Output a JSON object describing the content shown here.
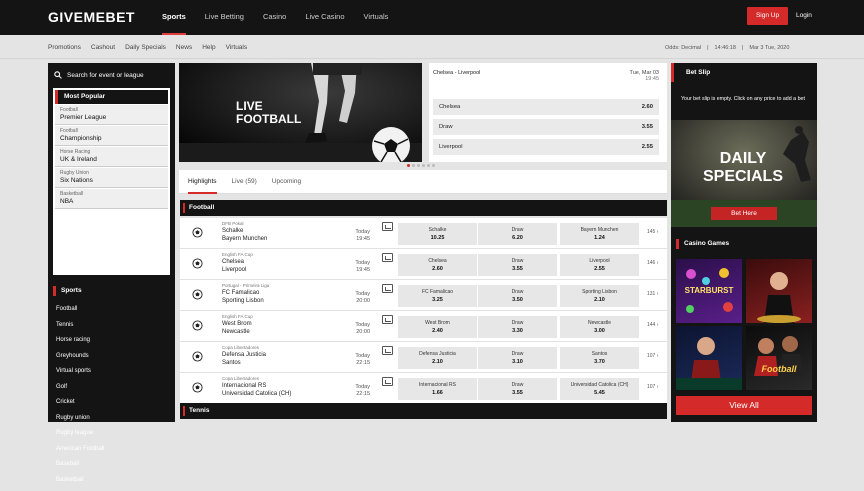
{
  "header": {
    "logo": "GIVEMEBET",
    "nav": [
      "Sports",
      "Live Betting",
      "Casino",
      "Live Casino",
      "Virtuals"
    ],
    "signup": "Sign Up",
    "login": "Login"
  },
  "subnav": {
    "items": [
      "Promotions",
      "Cashout",
      "Daily Specials",
      "News",
      "Help",
      "Virtuals"
    ],
    "odds": "Odds: Decimal",
    "time": "14:46:18",
    "date": "Mar 3 Tue, 2020"
  },
  "sidebar": {
    "search_label": "Search for event or league",
    "most_popular": "Most Popular",
    "popular": [
      {
        "sport": "Football",
        "league": "Premier League"
      },
      {
        "sport": "Football",
        "league": "Championship"
      },
      {
        "sport": "Horse Racing",
        "league": "UK & Ireland"
      },
      {
        "sport": "Rugby Union",
        "league": "Six Nations"
      },
      {
        "sport": "Basketball",
        "league": "NBA"
      }
    ],
    "sports_title": "Sports",
    "sports": [
      "Football",
      "Tennis",
      "Horse racing",
      "Greyhounds",
      "Virtual sports",
      "Golf",
      "Cricket",
      "Rugby union",
      "Rugby league",
      "American Football",
      "Baseball",
      "Basketball"
    ]
  },
  "hero": {
    "line1": "LIVE",
    "line2": "FOOTBALL",
    "match": "Chelsea - Liverpool",
    "date": "Tue, Mar 03",
    "time": "19:45",
    "odds": [
      {
        "name": "Chelsea",
        "price": "2.60"
      },
      {
        "name": "Draw",
        "price": "3.55"
      },
      {
        "name": "Liverpool",
        "price": "2.55"
      }
    ]
  },
  "tabs": [
    "Highlights",
    "Live (59)",
    "Upcoming"
  ],
  "sections": {
    "football": "Football",
    "tennis": "Tennis"
  },
  "matches": [
    {
      "comp": "DFB Pokal",
      "home": "Schalke",
      "away": "Bayern Munchen",
      "day": "Today",
      "time": "19:45",
      "odds": [
        {
          "n": "Schalke",
          "p": "10.25"
        },
        {
          "n": "Draw",
          "p": "6.20"
        },
        {
          "n": "Bayern Munchen",
          "p": "1.24"
        }
      ],
      "more": "145"
    },
    {
      "comp": "English FA Cup",
      "home": "Chelsea",
      "away": "Liverpool",
      "day": "Today",
      "time": "19:45",
      "odds": [
        {
          "n": "Chelsea",
          "p": "2.60"
        },
        {
          "n": "Draw",
          "p": "3.55"
        },
        {
          "n": "Liverpool",
          "p": "2.55"
        }
      ],
      "more": "146"
    },
    {
      "comp": "Portugal - Primeira Liga",
      "home": "FC Famalicao",
      "away": "Sporting Lisbon",
      "day": "Today",
      "time": "20:00",
      "odds": [
        {
          "n": "FC Famalicao",
          "p": "3.25"
        },
        {
          "n": "Draw",
          "p": "3.50"
        },
        {
          "n": "Sporting Lisbon",
          "p": "2.10"
        }
      ],
      "more": "131"
    },
    {
      "comp": "English FA Cup",
      "home": "West Brom",
      "away": "Newcastle",
      "day": "Today",
      "time": "20:00",
      "odds": [
        {
          "n": "West Brom",
          "p": "2.40"
        },
        {
          "n": "Draw",
          "p": "3.30"
        },
        {
          "n": "Newcastle",
          "p": "3.00"
        }
      ],
      "more": "144"
    },
    {
      "comp": "Copa Libertadores",
      "home": "Defensa Justicia",
      "away": "Santos",
      "day": "Today",
      "time": "22:15",
      "odds": [
        {
          "n": "Defensa Justicia",
          "p": "2.10"
        },
        {
          "n": "Draw",
          "p": "3.10"
        },
        {
          "n": "Santos",
          "p": "3.70"
        }
      ],
      "more": "107"
    },
    {
      "comp": "Copa Libertadores",
      "home": "Internacional RS",
      "away": "Universidad Catolica (CH)",
      "day": "Today",
      "time": "22:15",
      "odds": [
        {
          "n": "Internacional RS",
          "p": "1.66"
        },
        {
          "n": "Draw",
          "p": "3.55"
        },
        {
          "n": "Universidad Catolica (CH)",
          "p": "5.45"
        }
      ],
      "more": "107"
    }
  ],
  "betslip": {
    "title": "Bet Slip",
    "message": "Your bet slip is empty. Click on any price to add a bet"
  },
  "promo": {
    "line1": "DAILY",
    "line2": "SPECIALS",
    "button": "Bet Here"
  },
  "casino": {
    "title": "Casino Games",
    "view_all": "View All",
    "games": [
      {
        "label": "STARBURST"
      },
      {
        "label": ""
      },
      {
        "label": ""
      },
      {
        "label": "Football"
      }
    ]
  }
}
